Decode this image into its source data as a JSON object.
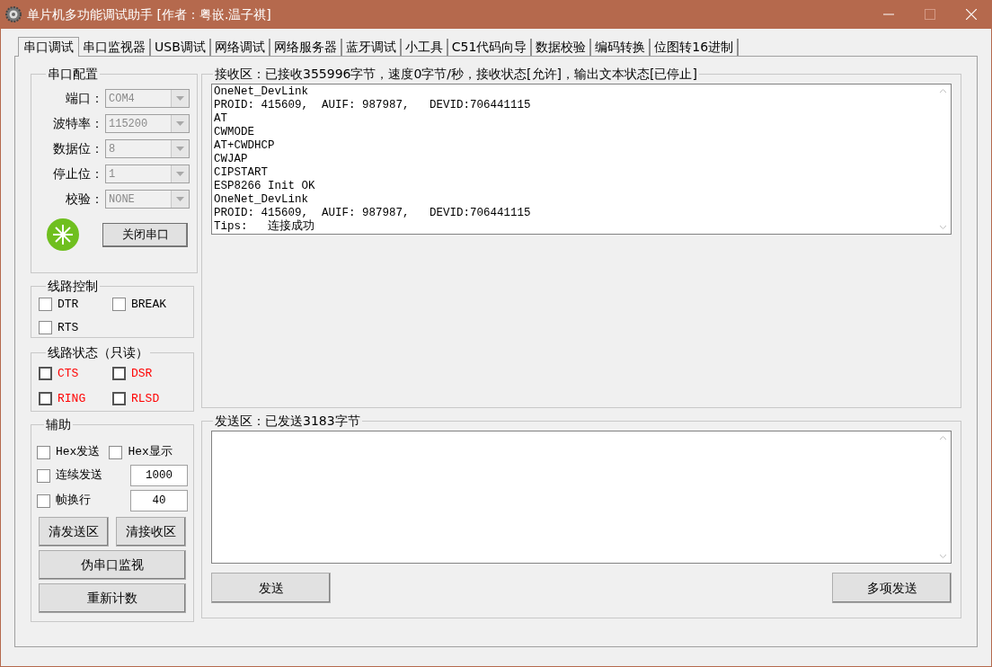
{
  "window": {
    "title": "单片机多功能调试助手 [作者：粤嵌.温子祺]",
    "controls": [
      {
        "kind": "minimize",
        "disabled": false
      },
      {
        "kind": "maximize",
        "disabled": true
      },
      {
        "kind": "close",
        "disabled": false
      }
    ]
  },
  "tabs": [
    {
      "label": "串口调试",
      "selected": true
    },
    {
      "label": "串口监视器",
      "selected": false
    },
    {
      "label": "USB调试",
      "selected": false
    },
    {
      "label": "网络调试",
      "selected": false
    },
    {
      "label": "网络服务器",
      "selected": false
    },
    {
      "label": "蓝牙调试",
      "selected": false
    },
    {
      "label": "小工具",
      "selected": false
    },
    {
      "label": "C51代码向导",
      "selected": false
    },
    {
      "label": "数据校验",
      "selected": false
    },
    {
      "label": "编码转换",
      "selected": false
    },
    {
      "label": "位图转16进制",
      "selected": false
    }
  ],
  "serial_config": {
    "title": "串口配置",
    "fields": [
      {
        "label": "端口：",
        "value": "COM4",
        "disabled": true
      },
      {
        "label": "波特率：",
        "value": "115200",
        "disabled": true
      },
      {
        "label": "数据位：",
        "value": "8",
        "disabled": true
      },
      {
        "label": "停止位：",
        "value": "1",
        "disabled": true
      },
      {
        "label": "校验：",
        "value": "NONE",
        "disabled": true
      }
    ],
    "open": true,
    "button": "关闭串口"
  },
  "line_control": {
    "title": "线路控制",
    "items": [
      {
        "label": "DTR",
        "checked": false
      },
      {
        "label": "BREAK",
        "checked": false
      },
      {
        "label": "RTS",
        "checked": false
      }
    ]
  },
  "line_status": {
    "title": "线路状态（只读）",
    "items": [
      {
        "label": "CTS",
        "checked": false
      },
      {
        "label": "DSR",
        "checked": false
      },
      {
        "label": "RING",
        "checked": false
      },
      {
        "label": "RLSD",
        "checked": false
      }
    ]
  },
  "auxiliary": {
    "title": "辅助",
    "options": [
      {
        "label": "Hex发送",
        "checked": false
      },
      {
        "label": "Hex显示",
        "checked": false
      },
      {
        "label": "连续发送",
        "checked": false,
        "value": "1000"
      },
      {
        "label": "帧换行",
        "checked": false,
        "value": "40"
      }
    ],
    "buttons": [
      "清发送区",
      "清接收区",
      "伪串口监视",
      "重新计数"
    ]
  },
  "receive": {
    "title": "接收区：已接收355996字节，速度0字节/秒，接收状态[允许]，输出文本状态[已停止]",
    "lines": [
      "OneNet_DevLink",
      "PROID: 415609,  AUIF: 987987,   DEVID:706441115",
      "AT",
      "CWMODE",
      "AT+CWDHCP",
      "CWJAP",
      "CIPSTART",
      "ESP8266 Init OK",
      "OneNet_DevLink",
      "PROID: 415609,  AUIF: 987987,   DEVID:706441115",
      "Tips:   连接成功"
    ]
  },
  "send": {
    "title": "发送区：已发送3183字节",
    "buttons": [
      "发送",
      "多项发送"
    ]
  }
}
